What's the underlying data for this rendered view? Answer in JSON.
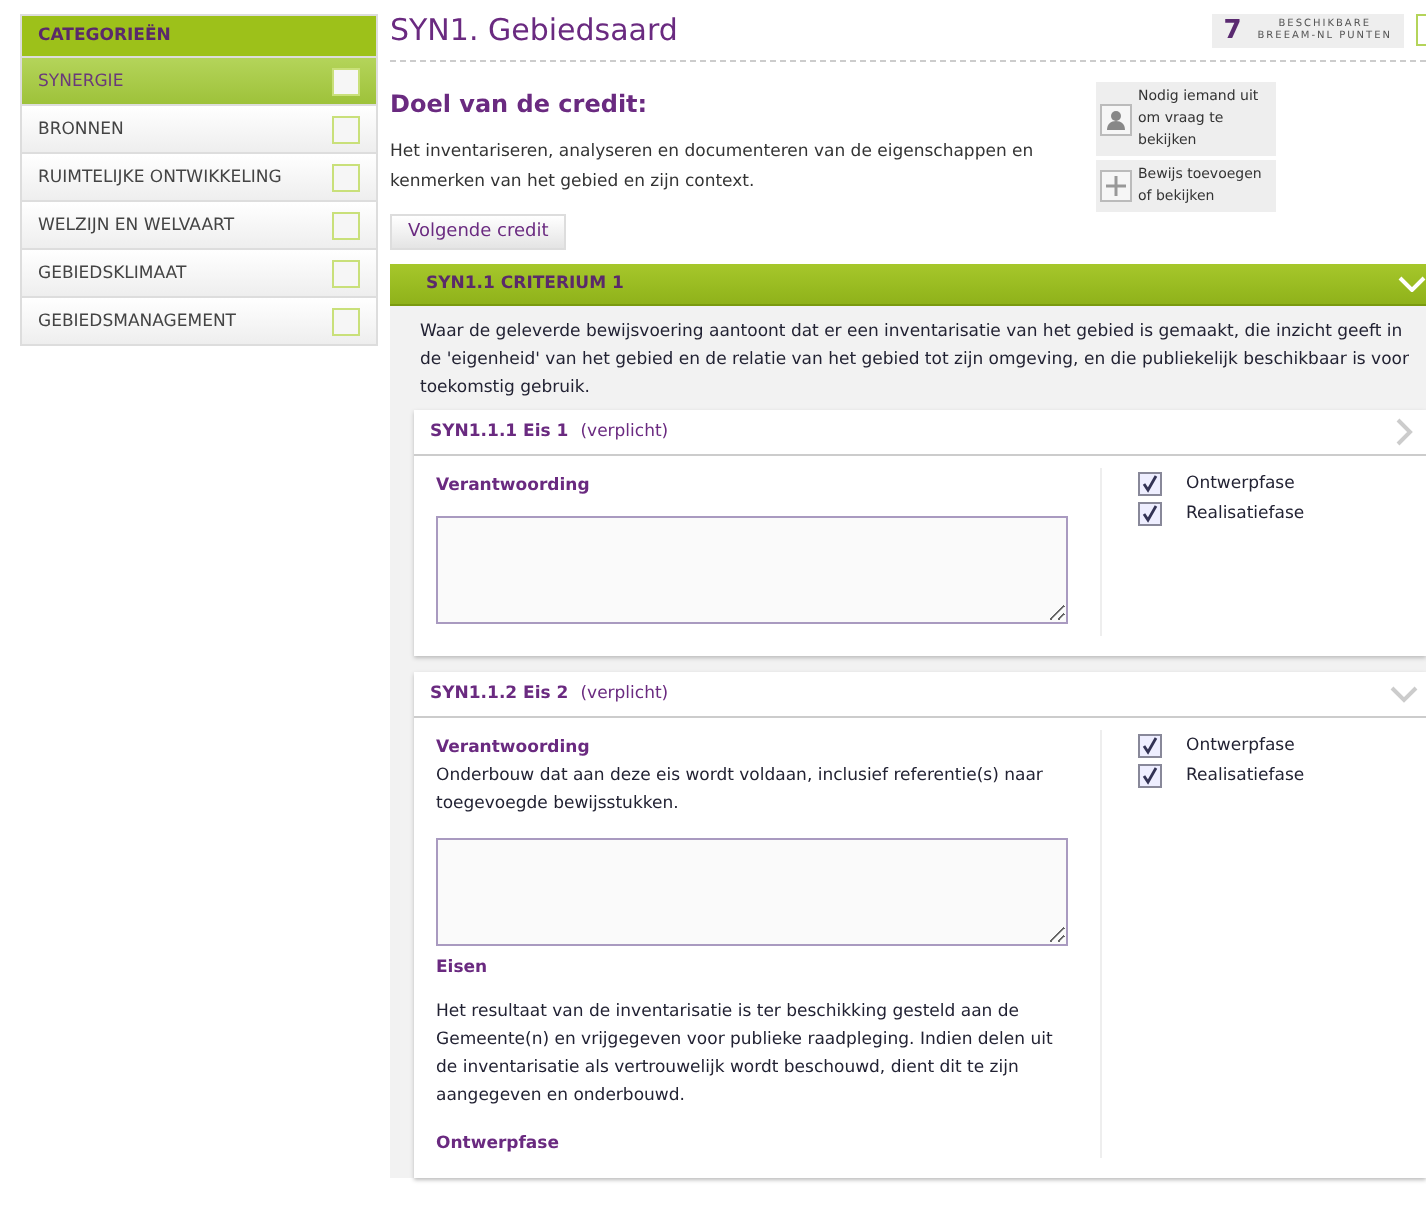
{
  "sidebar": {
    "title": "CATEGORIEËN",
    "items": [
      {
        "label": "SYNERGIE",
        "selected": true,
        "checked": false
      },
      {
        "label": "BRONNEN",
        "selected": false,
        "checked": false
      },
      {
        "label": "RUIMTELIJKE ONTWIKKELING",
        "selected": false,
        "checked": false
      },
      {
        "label": "WELZIJN EN WELVAART",
        "selected": false,
        "checked": false
      },
      {
        "label": "GEBIEDSKLIMAAT",
        "selected": false,
        "checked": false
      },
      {
        "label": "GEBIEDSMANAGEMENT",
        "selected": false,
        "checked": false
      }
    ]
  },
  "header": {
    "title": "SYN1. Gebiedsaard",
    "points": "7",
    "points_label_1": "BESCHIKBARE",
    "points_label_2": "BREEAM-NL PUNTEN"
  },
  "goal": {
    "heading": "Doel van de credit:",
    "text": "Het inventariseren, analyseren en documenteren van de eigenschappen en kenmerken van het gebied en zijn context.",
    "next_button": "Volgende credit"
  },
  "actions": [
    {
      "kind": "person",
      "label": "Nodig iemand uit om vraag te bekijken"
    },
    {
      "kind": "add",
      "label": "Bewijs toevoegen of bekijken"
    }
  ],
  "criterion": {
    "title": "SYN1.1 CRITERIUM 1",
    "expanded": true,
    "text": "Waar de geleverde bewijsvoering aantoont dat er een inventarisatie van het gebied is gemaakt, die inzicht geeft in de 'eigenheid' van het gebied en de relatie van het gebied tot zijn omgeving, en die publiekelijk beschikbaar is voor toekomstig gebruik.",
    "requirements": [
      {
        "title": "SYN1.1.1 Eis 1",
        "note": "(verplicht)",
        "expanded": false,
        "answer_label": "Verantwoording",
        "phases": [
          {
            "label": "Ontwerpfase",
            "checked": true
          },
          {
            "label": "Realisatiefase",
            "checked": true
          }
        ]
      },
      {
        "title": "SYN1.1.2 Eis 2",
        "note": "(verplicht)",
        "expanded": true,
        "answer_label": "Verantwoording",
        "answer_hint": "Onderbouw dat aan deze eis wordt voldaan, inclusief referentie(s) naar toegevoegde bewijsstukken.",
        "requirements_heading": "Eisen",
        "requirements_text": "Het resultaat van de inventarisatie is ter beschikking gesteld aan de Gemeente(n) en vrijgegeven voor publieke raadpleging. Indien delen uit de inventarisatie als vertrouwelijk wordt beschouwd, dient dit te zijn aangegeven en onderbouwd.",
        "phase_heading": "Ontwerpfase",
        "phases": [
          {
            "label": "Ontwerpfase",
            "checked": true
          },
          {
            "label": "Realisatiefase",
            "checked": true
          }
        ]
      }
    ]
  }
}
